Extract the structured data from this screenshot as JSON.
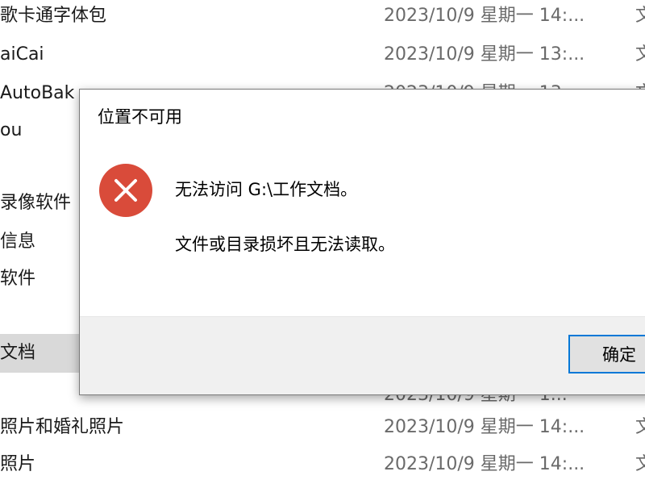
{
  "explorer": {
    "rows": [
      {
        "name": "歌卡通字体包",
        "date": "2023/10/9 星期一 14:...",
        "edge": "文"
      },
      {
        "name": "aiCai",
        "date": "2023/10/9 星期一 13:...",
        "edge": "文"
      },
      {
        "name": "AutoBak",
        "date": "2023/10/9 星期一 13:...",
        "edge": "文"
      },
      {
        "name": "ou",
        "date": "",
        "edge": ""
      },
      {
        "name": "",
        "date": "",
        "edge": ""
      },
      {
        "name": "录像软件",
        "date": "",
        "edge": ""
      },
      {
        "name": "信息",
        "date": "",
        "edge": ""
      },
      {
        "name": "软件",
        "date": "",
        "edge": ""
      },
      {
        "name": "",
        "date": "",
        "edge": ""
      },
      {
        "name": "文档",
        "date": "",
        "edge": ""
      },
      {
        "name": "",
        "date": "2023/10/9 星期一 1...",
        "edge": ""
      },
      {
        "name": "照片和婚礼照片",
        "date": "2023/10/9 星期一 14:...",
        "edge": "文"
      },
      {
        "name": "照片",
        "date": "2023/10/9 星期一 14:...",
        "edge": "文"
      }
    ]
  },
  "dialog": {
    "title": "位置不可用",
    "message_line1": "无法访问 G:\\工作文档。",
    "message_line2": "文件或目录损坏且无法读取。",
    "ok_label": "确定",
    "icon": "error-x-icon",
    "icon_color": "#d94b3a",
    "button_border_color": "#0078d7"
  }
}
